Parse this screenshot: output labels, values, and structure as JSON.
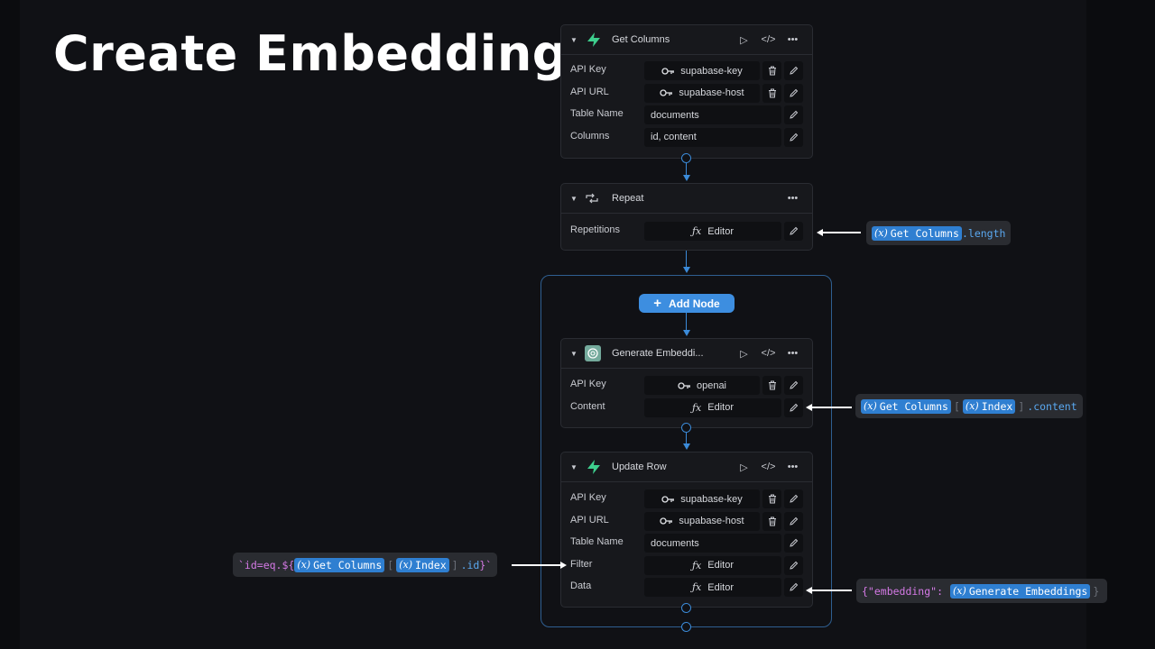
{
  "title": "Create Embeddings",
  "nodes": {
    "get_columns": {
      "title": "Get Columns",
      "icon": "supabase-icon",
      "rows": [
        {
          "label": "API Key",
          "value": "supabase-key"
        },
        {
          "label": "API URL",
          "value": "supabase-host"
        },
        {
          "label": "Table Name",
          "value": "documents"
        },
        {
          "label": "Columns",
          "value": "id, content"
        }
      ]
    },
    "repeat": {
      "title": "Repeat",
      "icon": "repeat-icon",
      "rows": [
        {
          "label": "Repetitions",
          "value": "Editor"
        }
      ]
    },
    "generate_embeddings": {
      "title": "Generate Embeddi...",
      "icon": "openai-icon",
      "rows": [
        {
          "label": "API Key",
          "value": "openai"
        },
        {
          "label": "Content",
          "value": "Editor"
        }
      ]
    },
    "update_row": {
      "title": "Update Row",
      "icon": "supabase-icon",
      "rows": [
        {
          "label": "API Key",
          "value": "supabase-key"
        },
        {
          "label": "API URL",
          "value": "supabase-host"
        },
        {
          "label": "Table Name",
          "value": "documents"
        },
        {
          "label": "Filter",
          "value": "Editor"
        },
        {
          "label": "Data",
          "value": "Editor"
        }
      ]
    }
  },
  "add_node_label": "Add Node",
  "annotations": {
    "repetitions": {
      "chip": "Get Columns",
      "suffix": ".length"
    },
    "content": {
      "chip1": "Get Columns",
      "open": "[",
      "chip2": "Index",
      "close": "]",
      "suffix": ".content"
    },
    "filter": {
      "prefix": "`id=eq.${",
      "chip1": "Get Columns",
      "open": "[",
      "chip2": "Index",
      "close": "]",
      "suffix": ".id",
      "end": "}`"
    },
    "data": {
      "prefix": "{\"embedding\":",
      "chip": "Generate Embeddings",
      "end": "}"
    }
  },
  "colors": {
    "accent": "#3d8ee0",
    "supabase_green": "#3ecf8e",
    "openai_teal": "#74aa9c"
  }
}
